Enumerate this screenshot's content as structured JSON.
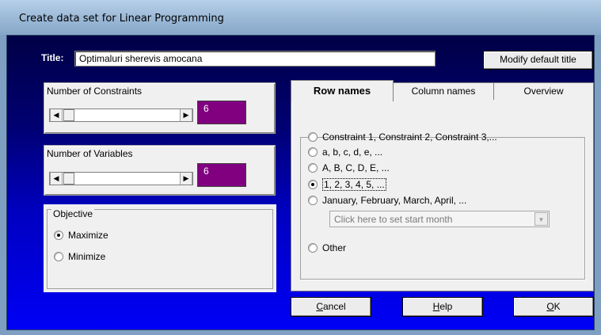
{
  "window": {
    "title": "Create data set for Linear Programming"
  },
  "title_row": {
    "label": "Title:",
    "value": "Optimaluri sherevis amocana",
    "modify_button": "Modify default title"
  },
  "constraints": {
    "label": "Number of Constraints",
    "value": "6"
  },
  "variables": {
    "label": "Number of Variables",
    "value": "6"
  },
  "objective": {
    "legend": "Objective",
    "options": [
      "Maximize",
      "Minimize"
    ],
    "selected": "Maximize"
  },
  "tabs": [
    "Row names",
    "Column names",
    "Overview"
  ],
  "active_tab": "Row names",
  "row_names": {
    "options": [
      "Constraint 1, Constraint 2, Constraint 3,...",
      "a, b, c, d, e, ...",
      "A, B, C, D, E, ...",
      "1, 2, 3, 4, 5, ...",
      "January, February, March, April, ...",
      "Other"
    ],
    "selected": "1, 2, 3, 4, 5, ...",
    "month_placeholder": "Click here to set start month"
  },
  "buttons": {
    "cancel": {
      "mnemonic": "C",
      "rest": "ancel"
    },
    "help": {
      "mnemonic": "H",
      "rest": "elp"
    },
    "ok": {
      "mnemonic": "O",
      "rest": "K"
    }
  },
  "colors": {
    "value_box": "#800080",
    "client_gradient_top": "#000046",
    "client_gradient_bottom": "#0000f6"
  }
}
